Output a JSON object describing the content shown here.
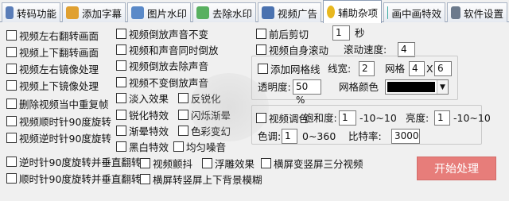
{
  "tabs": [
    {
      "label": "转码功能",
      "icon": "gear-icon",
      "color": "#5a7db8"
    },
    {
      "label": "添加字幕",
      "icon": "pencil-icon",
      "color": "#e0a030"
    },
    {
      "label": "图片水印",
      "icon": "image-icon",
      "color": "#5a89c8"
    },
    {
      "label": "去除水印",
      "icon": "eraser-icon",
      "color": "#58b060"
    },
    {
      "label": "视频广告",
      "icon": "camera-icon",
      "color": "#4a72b0"
    },
    {
      "label": "辅助杂项",
      "icon": "sun-icon",
      "color": "#e8b820"
    },
    {
      "label": "画中画特效",
      "icon": "window-icon",
      "color": "#3aa8a0"
    },
    {
      "label": "软件设置",
      "icon": "settings-icon",
      "color": "#6c7a8c"
    }
  ],
  "active_tab": "辅助杂项",
  "left_options": [
    "视频左右翻转画面",
    "视频上下翻转画面",
    "视频左右镜像处理",
    "视频上下镜像处理",
    "删除视频当中重复帧",
    "视频顺时针90度旋转",
    "视频逆时针90度旋转"
  ],
  "mid_options": [
    "视频倒放声音不变",
    "视频和声音同时倒放",
    "视频倒放去除声音",
    "视频不变倒放声音",
    "淡入效果",
    "锐化特效",
    "渐晕特效",
    "黑白特效"
  ],
  "mid_options2": [
    "反锐化",
    "闪烁渐晕",
    "色彩变幻",
    "均匀噪音"
  ],
  "bottom_row1": [
    "逆时针90度旋转并垂直翻转",
    "视频颤抖",
    "浮雕效果",
    "横屏变竖屏三分视频"
  ],
  "bottom_row2": [
    "顺时针90度旋转并垂直翻转",
    "横屏转竖屏上下背景模糊"
  ],
  "clip": {
    "label": "前后剪切",
    "value": "1",
    "unit": "秒"
  },
  "auto_scroll": {
    "label": "视频自身滚动",
    "speed_label": "滚动速度:",
    "speed_value": "4"
  },
  "grid": {
    "label": "添加网格线",
    "width_label": "线宽:",
    "width_value": "2",
    "grid_label": "网格",
    "rows": "4",
    "times": "X",
    "cols": "6",
    "opacity_label": "透明度:",
    "opacity_value": "50 %",
    "color_label": "网格颜色",
    "color_value": "#000000"
  },
  "tone": {
    "label": "视频调色",
    "saturation_label": "饱和度:",
    "saturation_value": "1",
    "saturation_range": "-10~10",
    "brightness_label": "亮度:",
    "brightness_value": "1",
    "brightness_range": "-10~10",
    "hue_label": "色调:",
    "hue_value": "1",
    "hue_range": "0~360",
    "bitrate_label": "比特率:",
    "bitrate_value": "3000"
  },
  "start_button": "开始处理"
}
